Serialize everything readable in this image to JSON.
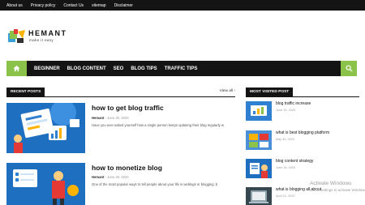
{
  "topbar": {
    "links": [
      "About us",
      "Privacy policy",
      "Contact Us",
      "sitemap",
      "Disclaimer"
    ]
  },
  "logo": {
    "title": "HEMANT",
    "tagline": "make it easy"
  },
  "nav": {
    "items": [
      "BEGINNER",
      "BLOG CONTENT",
      "SEO",
      "BLOG TIPS",
      "TRAFFIC TIPS"
    ],
    "home_icon": "home-icon",
    "search_icon": "search-icon"
  },
  "recent": {
    "label": "RECENT POSTS",
    "view_all": "View all",
    "posts": [
      {
        "title": "how to get blog traffic",
        "author": "Hemant",
        "date": "June 30, 2020",
        "excerpt": "Have you ever asked yourself how a single person keeps updating their blog regularly w"
      },
      {
        "title": "how to monetize blog",
        "author": "Hemant",
        "date": "June 29, 2020",
        "excerpt": "One of the most popular ways to tell people about your life is weblogs or blogging. b"
      }
    ]
  },
  "popular": {
    "label": "MOST VISITED POST",
    "items": [
      {
        "title": "blog traffic increase",
        "date": "June 15, 2020"
      },
      {
        "title": "what is best blogging platform",
        "date": "May 30, 2020"
      },
      {
        "title": "blog content strategy",
        "date": "June 16, 2020"
      },
      {
        "title": "what is blogging all about",
        "date": "April 22, 2020"
      }
    ]
  },
  "watermark": {
    "title": "Activate Windows",
    "subtitle": "Go to Settings to activate Windows."
  },
  "colors": {
    "accent": "#8bc34a",
    "dark": "#141414"
  }
}
